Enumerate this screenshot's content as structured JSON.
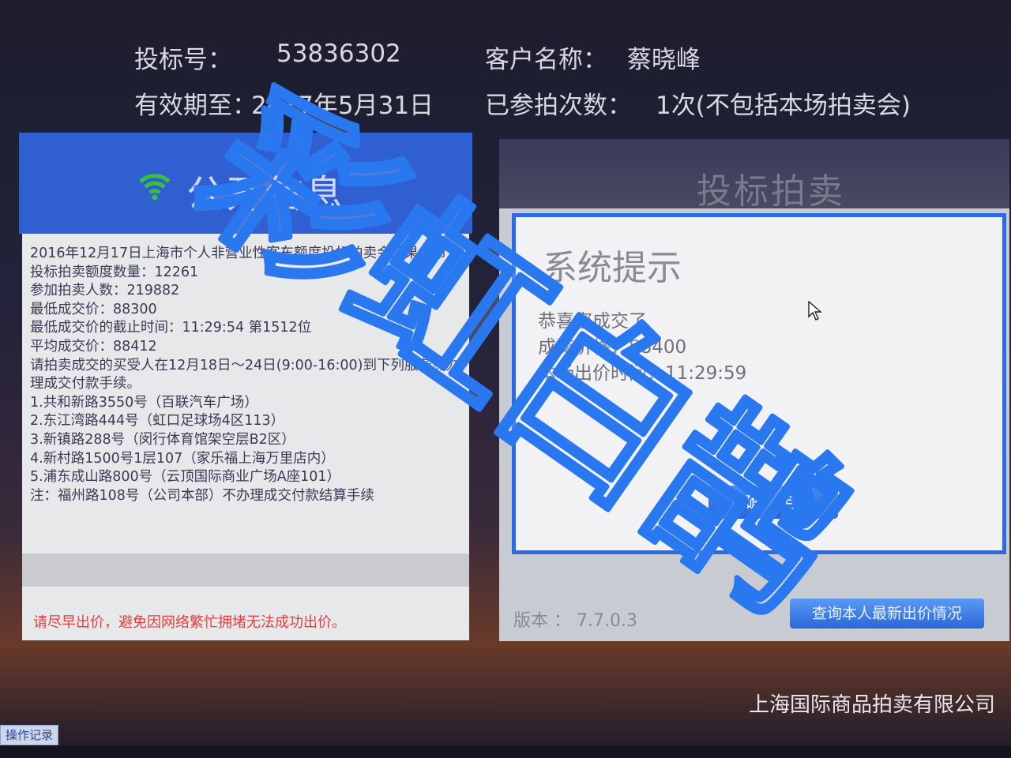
{
  "header": {
    "bid_no_label": "投标号：",
    "bid_no": "53836302",
    "customer_label": "客户名称：",
    "customer_name": "蔡晓峰",
    "valid_label": "有效期至：",
    "valid_date": "2017年5月31日",
    "count_label": "已参拍次数：",
    "count_value": "1次(不包括本场拍卖会)"
  },
  "left_panel": {
    "title": "公开信息",
    "notice_lines": [
      "2016年12月17日上海市个人非营业性客车额度投标拍卖会结果公布",
      "投标拍卖额度数量：12261",
      "参加拍卖人数：219882",
      "最低成交价：88300",
      "最低成交价的截止时间：11:29:54 第1512位",
      "平均成交价：88412",
      "请拍卖成交的买受人在12月18日～24日(9:00-16:00)到下列服务点办理成交付款手续。",
      "1.共和新路3550号（百联汽车广场）",
      "2.东江湾路444号（虹口足球场4区113）",
      "3.新镇路288号（闵行体育馆架空层B2区）",
      "4.新村路1500号1层107（家乐福上海万里店内）",
      "5.浦东成山路800号（云顶国际商业广场A座101）",
      "注：福州路108号（公司本部）不办理成交付款结算手续"
    ],
    "warning": "请尽早出价，避免因网络繁忙拥堵无法成功出价。"
  },
  "right_panel": {
    "title": "投标拍卖",
    "dialog": {
      "title": "系统提示",
      "line1": "恭喜您成交了",
      "line2": "成交价格：88400",
      "line3": "本场出价时间：11:29:59",
      "confirm": "确 定"
    },
    "version": "版本 ： 7.7.0.3",
    "query_button": "查询本人最新出价情况"
  },
  "footer": {
    "company": "上海国际商品拍卖有限公司",
    "op_log": "操作记录"
  },
  "colors": {
    "blue_header": "#2f5fd0",
    "dialog_border": "#2a6ae8",
    "warning": "#e04040",
    "wifi": "#3ac040"
  },
  "watermark": {
    "text": "彩虹白鹊",
    "color": "#2a78f0"
  }
}
